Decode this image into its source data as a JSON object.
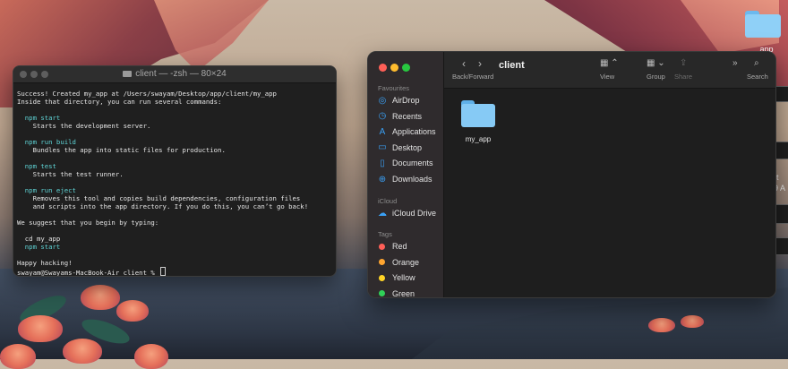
{
  "desktop": {
    "folder_label": "app",
    "edge_widgets": [
      "",
      "",
      "ot",
      "9 A",
      "",
      ""
    ]
  },
  "terminal": {
    "title": "client — -zsh — 80×24",
    "lines": [
      {
        "text": "Success! Created my_app at /Users/swayam/Desktop/app/client/my_app",
        "style": "plain"
      },
      {
        "text": "Inside that directory, you can run several commands:",
        "style": "plain"
      },
      {
        "text": "",
        "style": "plain"
      },
      {
        "text": "  npm start",
        "style": "cmd"
      },
      {
        "text": "    Starts the development server.",
        "style": "plain"
      },
      {
        "text": "",
        "style": "plain"
      },
      {
        "text": "  npm run build",
        "style": "cmd"
      },
      {
        "text": "    Bundles the app into static files for production.",
        "style": "plain"
      },
      {
        "text": "",
        "style": "plain"
      },
      {
        "text": "  npm test",
        "style": "cmd"
      },
      {
        "text": "    Starts the test runner.",
        "style": "plain"
      },
      {
        "text": "",
        "style": "plain"
      },
      {
        "text": "  npm run eject",
        "style": "cmd"
      },
      {
        "text": "    Removes this tool and copies build dependencies, configuration files",
        "style": "plain"
      },
      {
        "text": "    and scripts into the app directory. If you do this, you can’t go back!",
        "style": "plain"
      },
      {
        "text": "",
        "style": "plain"
      },
      {
        "text": "We suggest that you begin by typing:",
        "style": "plain"
      },
      {
        "text": "",
        "style": "plain"
      },
      {
        "text": "  cd my_app",
        "style": "cmd-cd"
      },
      {
        "text": "  npm start",
        "style": "cmd"
      },
      {
        "text": "",
        "style": "plain"
      },
      {
        "text": "Happy hacking!",
        "style": "plain"
      },
      {
        "text": "swayam@Swayams-MacBook-Air client % ",
        "style": "prompt"
      }
    ]
  },
  "finder": {
    "sidebar": {
      "favourites_label": "Favourites",
      "favourites": [
        {
          "label": "AirDrop",
          "icon": "airdrop-icon",
          "glyph": "◎"
        },
        {
          "label": "Recents",
          "icon": "clock-icon",
          "glyph": "◷"
        },
        {
          "label": "Applications",
          "icon": "applications-icon",
          "glyph": "A"
        },
        {
          "label": "Desktop",
          "icon": "desktop-icon",
          "glyph": "▭"
        },
        {
          "label": "Documents",
          "icon": "document-icon",
          "glyph": "▯"
        },
        {
          "label": "Downloads",
          "icon": "download-icon",
          "glyph": "⊕"
        }
      ],
      "icloud_label": "iCloud",
      "icloud": [
        {
          "label": "iCloud Drive",
          "icon": "cloud-icon",
          "glyph": "☁"
        }
      ],
      "tags_label": "Tags",
      "tags": [
        {
          "label": "Red",
          "color": "#ff5f57"
        },
        {
          "label": "Orange",
          "color": "#ffa530"
        },
        {
          "label": "Yellow",
          "color": "#ffd426"
        },
        {
          "label": "Green",
          "color": "#30d158"
        }
      ]
    },
    "toolbar": {
      "title": "client",
      "back_forward_label": "Back/Forward",
      "view_label": "View",
      "group_label": "Group",
      "share_label": "Share",
      "search_label": "Search"
    },
    "items": [
      {
        "label": "my_app",
        "icon": "folder-icon"
      }
    ]
  }
}
